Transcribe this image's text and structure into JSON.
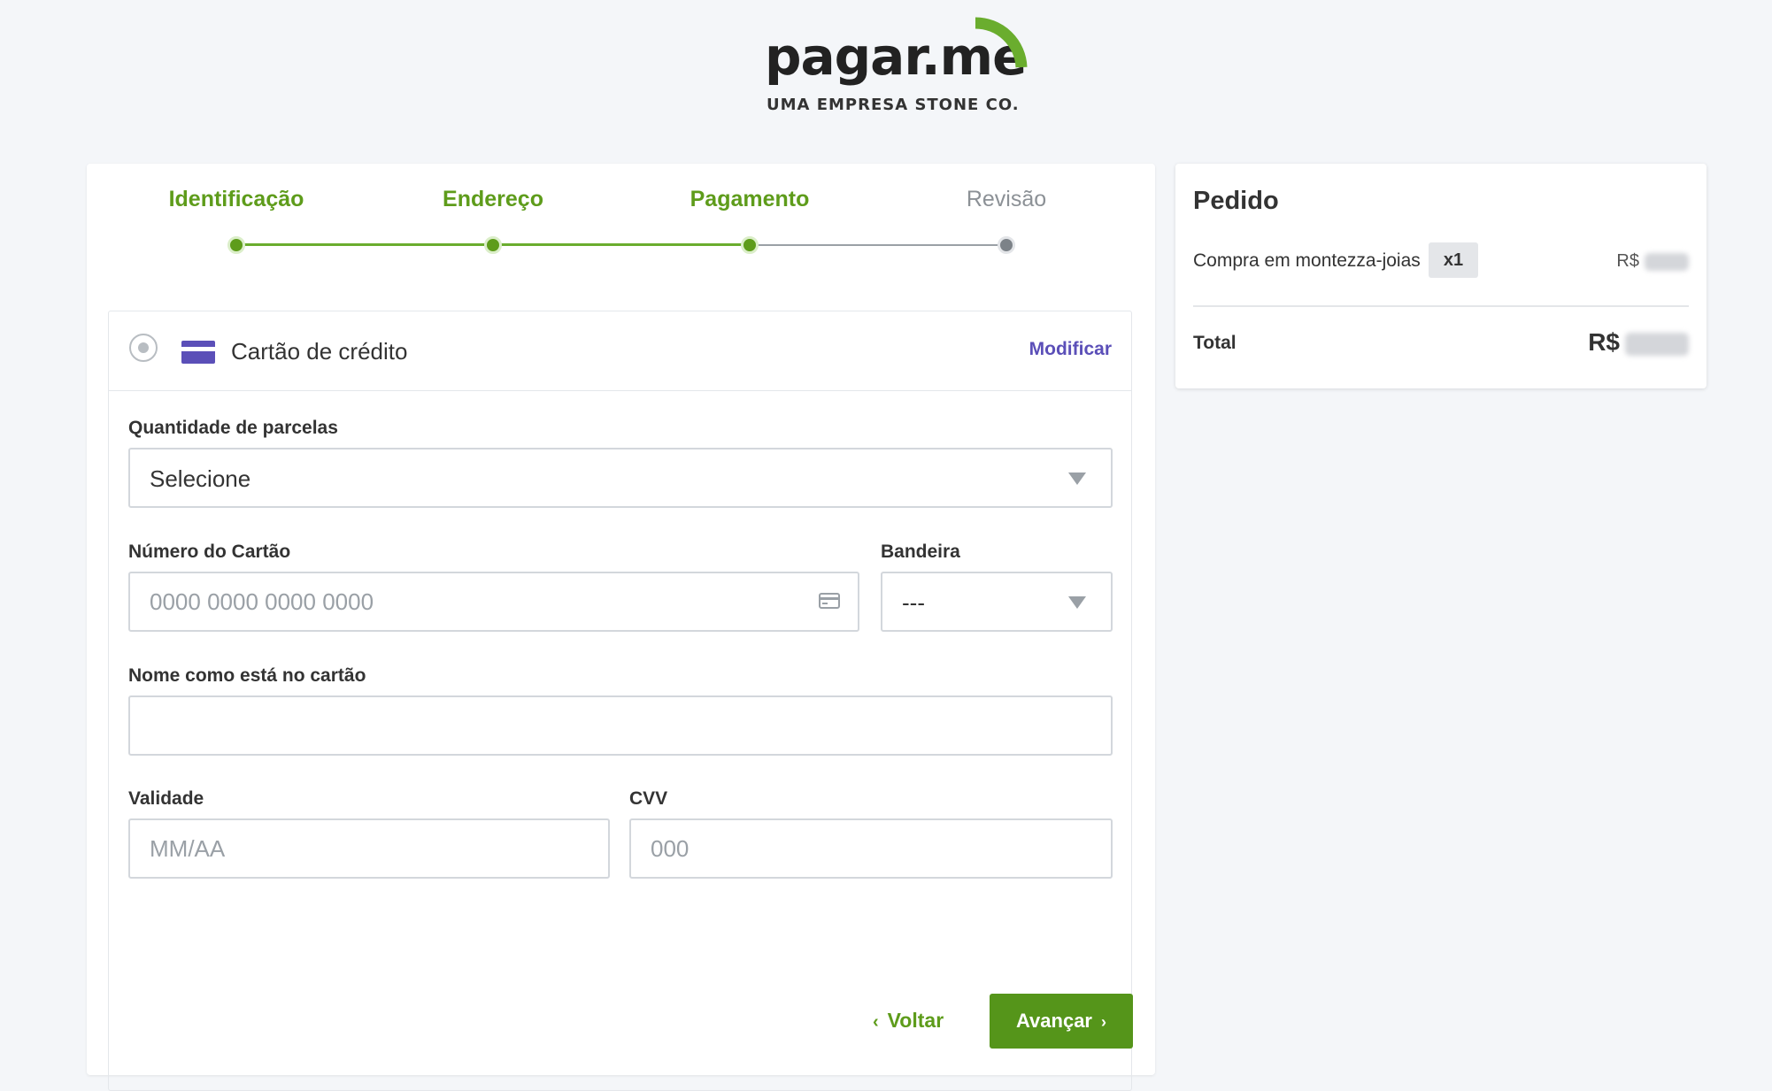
{
  "logo": {
    "wordmark": "pagar.me",
    "tagline": "UMA EMPRESA STONE CO.",
    "accent_color": "#6aad2e"
  },
  "stepper": {
    "steps": [
      {
        "label": "Identificação",
        "state": "done"
      },
      {
        "label": "Endereço",
        "state": "done"
      },
      {
        "label": "Pagamento",
        "state": "current"
      },
      {
        "label": "Revisão",
        "state": "todo"
      }
    ]
  },
  "payment": {
    "method_label": "Cartão de crédito",
    "method_icon": "credit-card-icon",
    "modify_label": "Modificar",
    "installments": {
      "label": "Quantidade de parcelas",
      "selected": "Selecione"
    },
    "card_number": {
      "label": "Número do Cartão",
      "placeholder": "0000 0000 0000 0000",
      "value": ""
    },
    "brand": {
      "label": "Bandeira",
      "selected": "---"
    },
    "holder_name": {
      "label": "Nome como está no cartão",
      "placeholder": "",
      "value": ""
    },
    "expiry": {
      "label": "Validade",
      "placeholder": "MM/AA",
      "value": ""
    },
    "cvv": {
      "label": "CVV",
      "placeholder": "000",
      "value": ""
    }
  },
  "actions": {
    "back_label": "Voltar",
    "next_label": "Avançar"
  },
  "order": {
    "title": "Pedido",
    "item_description": "Compra em montezza-joias",
    "item_quantity": "x1",
    "item_price_prefix": "R$",
    "total_label": "Total",
    "total_prefix": "R$"
  },
  "colors": {
    "primary_green": "#55951a",
    "step_done": "#5e9c1b",
    "step_todo": "#8c9196",
    "link_purple": "#5b4fb8",
    "background": "#f4f6f9"
  }
}
